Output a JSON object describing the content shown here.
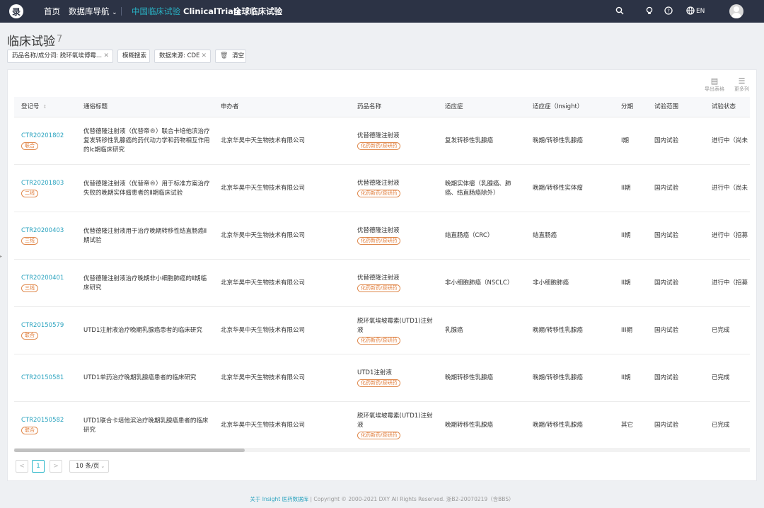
{
  "topnav": {
    "logo": "录",
    "items": [
      "首页",
      "数据库导航",
      "中国临床试验",
      "ClinicalTrials",
      "全球临床试验"
    ],
    "dropdown_glyph": "⌄",
    "lang": "EN",
    "icons": [
      "search-icon",
      "bulb-icon",
      "help-icon",
      "globe-icon",
      "avatar"
    ]
  },
  "page": {
    "title": "临床试验",
    "count": "7"
  },
  "filters": {
    "chip1": "药品名称/成分词: 脱环氧埃博霉...",
    "chip2": "模糊搜索",
    "chip3": "数据来源: CDE",
    "clear": "清空"
  },
  "tools": {
    "export": "导出表格",
    "more": "更多列"
  },
  "columns": {
    "reg": "登记号",
    "title": "通俗标题",
    "sponsor": "申办者",
    "drug": "药品名称",
    "indication": "适应症",
    "insight": "适应症（Insight）",
    "phase": "分期",
    "scope": "试验范围",
    "status": "试验状态"
  },
  "rows": [
    {
      "reg": "CTR20201802",
      "tag": "联合",
      "title": "优替德隆注射液（优替帝®）联合卡培他滨治疗复发转移性乳腺癌的药代动力学和药物相互作用的Ⅰc期临床研究",
      "sponsor": "北京华昊中天生物技术有限公司",
      "drug": "优替德隆注射液",
      "drugtag": "化药新药/原研药",
      "indication": "复发转移性乳腺癌",
      "insight": "晚期/转移性乳腺癌",
      "phase": "I期",
      "scope": "国内试验",
      "status": "进行中（尚未"
    },
    {
      "reg": "CTR20201803",
      "tag": "二线",
      "title": "优替德隆注射液（优替帝®）用于标准方案治疗失败的晚期实体瘤患者的Ⅱ期临床试验",
      "sponsor": "北京华昊中天生物技术有限公司",
      "drug": "优替德隆注射液",
      "drugtag": "化药新药/原研药",
      "indication": "晚期实体瘤（乳腺癌、肺癌、结直肠癌除外）",
      "insight": "晚期/转移性实体瘤",
      "phase": "II期",
      "scope": "国内试验",
      "status": "进行中（尚未"
    },
    {
      "reg": "CTR20200403",
      "tag": "三线",
      "title": "优替德隆注射液用于治疗晚期转移性结直肠癌Ⅱ期试验",
      "sponsor": "北京华昊中天生物技术有限公司",
      "drug": "优替德隆注射液",
      "drugtag": "化药新药/原研药",
      "indication": "结直肠癌（CRC）",
      "insight": "结直肠癌",
      "phase": "II期",
      "scope": "国内试验",
      "status": "进行中（招募"
    },
    {
      "reg": "CTR20200401",
      "tag": "三线",
      "title": "优替德隆注射液治疗晚期非小细胞肺癌的Ⅱ期临床研究",
      "sponsor": "北京华昊中天生物技术有限公司",
      "drug": "优替德隆注射液",
      "drugtag": "化药新药/原研药",
      "indication": "非小细胞肺癌（NSCLC）",
      "insight": "非小细胞肺癌",
      "phase": "II期",
      "scope": "国内试验",
      "status": "进行中（招募"
    },
    {
      "reg": "CTR20150579",
      "tag": "联合",
      "title": "UTD1注射液治疗晚期乳腺癌患者的临床研究",
      "sponsor": "北京华昊中天生物技术有限公司",
      "drug": "脱环氧埃坡霉素(UTD1)注射液",
      "drugtag": "化药新药/原研药",
      "indication": "乳腺癌",
      "insight": "晚期/转移性乳腺癌",
      "phase": "III期",
      "scope": "国内试验",
      "status": "已完成"
    },
    {
      "reg": "CTR20150581",
      "tag": "",
      "title": "UTD1单药治疗晚期乳腺癌患者的临床研究",
      "sponsor": "北京华昊中天生物技术有限公司",
      "drug": "UTD1注射液",
      "drugtag": "化药新药/原研药",
      "indication": "晚期转移性乳腺癌",
      "insight": "晚期/转移性乳腺癌",
      "phase": "II期",
      "scope": "国内试验",
      "status": "已完成"
    },
    {
      "reg": "CTR20150582",
      "tag": "联合",
      "title": "UTD1联合卡培他滨治疗晚期乳腺癌患者的临床研究",
      "sponsor": "北京华昊中天生物技术有限公司",
      "drug": "脱环氧埃坡霉素(UTD1)注射液",
      "drugtag": "化药新药/原研药",
      "indication": "晚期转移性乳腺癌",
      "insight": "晚期/转移性乳腺癌",
      "phase": "其它",
      "scope": "国内试验",
      "status": "已完成"
    }
  ],
  "pagination": {
    "prev": "<",
    "page": "1",
    "next": ">",
    "size": "10 条/页"
  },
  "footer": {
    "link": "关于 Insight 医药数据库",
    "text": " | Copyright © 2000-2021 DXY All Rights Reserved. 浙B2-20070219（含BBS）"
  }
}
